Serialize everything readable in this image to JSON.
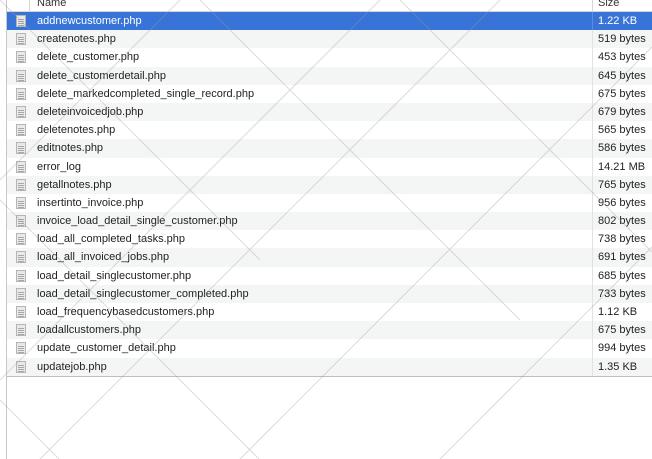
{
  "header": {
    "name_label": "Name",
    "size_label": "Size"
  },
  "files": [
    {
      "name": "addnewcustomer.php",
      "size": "1.22 KB",
      "selected": true
    },
    {
      "name": "createnotes.php",
      "size": "519 bytes"
    },
    {
      "name": "delete_customer.php",
      "size": "453 bytes"
    },
    {
      "name": "delete_customerdetail.php",
      "size": "645 bytes"
    },
    {
      "name": "delete_markedcompleted_single_record.php",
      "size": "675 bytes"
    },
    {
      "name": "deleteinvoicedjob.php",
      "size": "679 bytes"
    },
    {
      "name": "deletenotes.php",
      "size": "565 bytes"
    },
    {
      "name": "editnotes.php",
      "size": "586 bytes"
    },
    {
      "name": "error_log",
      "size": "14.21 MB"
    },
    {
      "name": "getallnotes.php",
      "size": "765 bytes"
    },
    {
      "name": "insertinto_invoice.php",
      "size": "956 bytes"
    },
    {
      "name": "invoice_load_detail_single_customer.php",
      "size": "802 bytes"
    },
    {
      "name": "load_all_completed_tasks.php",
      "size": "738 bytes"
    },
    {
      "name": "load_all_invoiced_jobs.php",
      "size": "691 bytes"
    },
    {
      "name": "load_detail_singlecustomer.php",
      "size": "685 bytes"
    },
    {
      "name": "load_detail_singlecustomer_completed.php",
      "size": "733 bytes"
    },
    {
      "name": "load_frequencybasedcustomers.php",
      "size": "1.12 KB"
    },
    {
      "name": "loadallcustomers.php",
      "size": "675 bytes"
    },
    {
      "name": "update_customer_detail.php",
      "size": "994 bytes"
    },
    {
      "name": "updatejob.php",
      "size": "1.35 KB"
    }
  ],
  "icons": {
    "file": "file-icon"
  },
  "colors": {
    "selection": "#3874d8",
    "stripe": "#f4f5f5"
  }
}
